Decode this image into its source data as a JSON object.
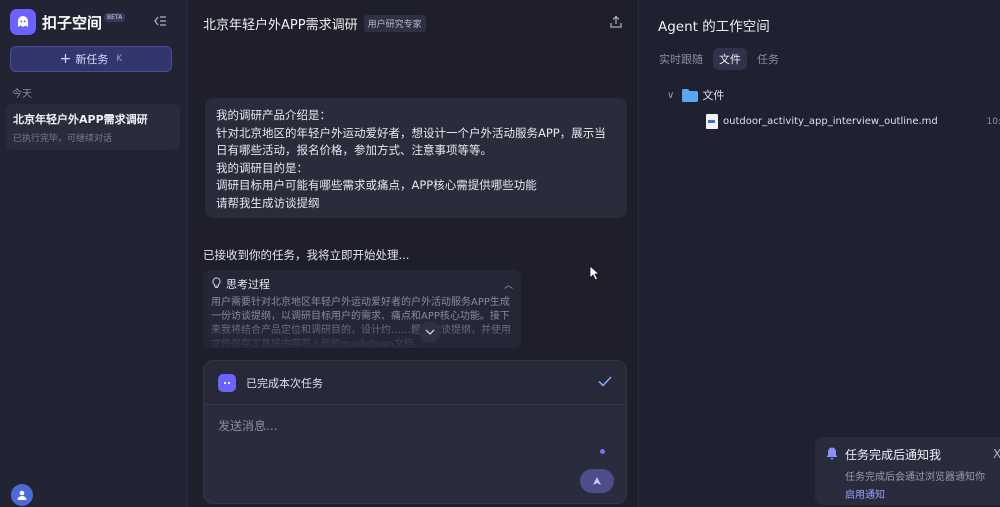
{
  "sidebar": {
    "brand": "扣子空间",
    "beta": "BETA",
    "new_task_label": "新任务",
    "new_task_hint": "K",
    "section_today": "今天",
    "history": [
      {
        "title": "北京年轻户外APP需求调研",
        "subtitle": "已执行完毕，可继续对话"
      }
    ]
  },
  "chat": {
    "title": "北京年轻户外APP需求调研",
    "tag": "用户研究专家",
    "user_message": [
      "我的调研产品介绍是：",
      "针对北京地区的年轻户外运动爱好者，想设计一个户外活动服务APP，展示当日有哪些活动，报名价格，参加方式、注意事项等等。",
      "我的调研目的是：",
      "调研目标用户可能有哪些需求或痛点，APP核心需提供哪些功能",
      "请帮我生成访谈提纲"
    ],
    "agent_reply": "已接收到你的任务，我将立即开始处理...",
    "thinking_title": "思考过程",
    "thinking_body": "用户需要针对北京地区年轻户外运动爱好者的户外活动服务APP生成一份访谈提纲，以调研目标用户的需求、痛点和APP核心功能。接下来我将结合产品定位和调研目的，设计约……题的访谈提纲，并使用文件保存工具将内容写入新的markdown文档。",
    "status": "已完成本次任务",
    "input_placeholder": "发送消息..."
  },
  "workspace": {
    "title": "Agent 的工作空间",
    "tabs": [
      "实时跟随",
      "文件",
      "任务"
    ],
    "active_tab": 1,
    "folder": "文件",
    "file": {
      "name": "outdoor_activity_app_interview_outline.md",
      "time": "10:"
    }
  },
  "notification": {
    "title": "任务完成后通知我",
    "desc": "任务完成后会通过浏览器通知你",
    "link": "启用通知",
    "close": "X"
  },
  "colors": {
    "accent": "#6b63ff",
    "background": "#1e1f2b",
    "link": "#8ea4ff"
  }
}
